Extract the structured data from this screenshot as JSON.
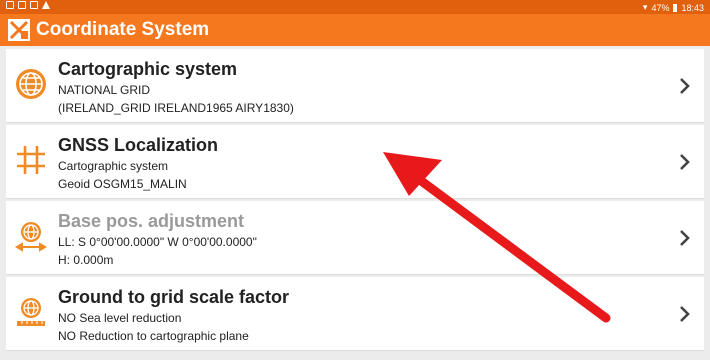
{
  "status": {
    "battery": "47%",
    "time": "18:43"
  },
  "appbar": {
    "title": "Coordinate System"
  },
  "rows": [
    {
      "title": "Cartographic system",
      "line1": "NATIONAL GRID",
      "line2": " (IRELAND_GRID IRELAND1965 AIRY1830)",
      "icon": "globe-icon",
      "enabled": true
    },
    {
      "title": "GNSS Localization",
      "line1": "Cartographic system",
      "line2": "Geoid OSGM15_MALIN",
      "icon": "grid-icon",
      "enabled": true
    },
    {
      "title": "Base pos. adjustment",
      "line1": "LL: S 0°00'00.0000\"  W 0°00'00.0000\"",
      "line2": "H: 0.000m",
      "icon": "globe-adjust-icon",
      "enabled": false
    },
    {
      "title": "Ground to grid scale factor",
      "line1": "NO Sea level reduction",
      "line2": "NO Reduction to cartographic plane",
      "icon": "globe-ruler-icon",
      "enabled": true
    }
  ],
  "colors": {
    "status_bar": "#e0600d",
    "app_bar": "#f5781f",
    "icon_orange": "#f08a24",
    "annotation_arrow": "#e8191a"
  }
}
